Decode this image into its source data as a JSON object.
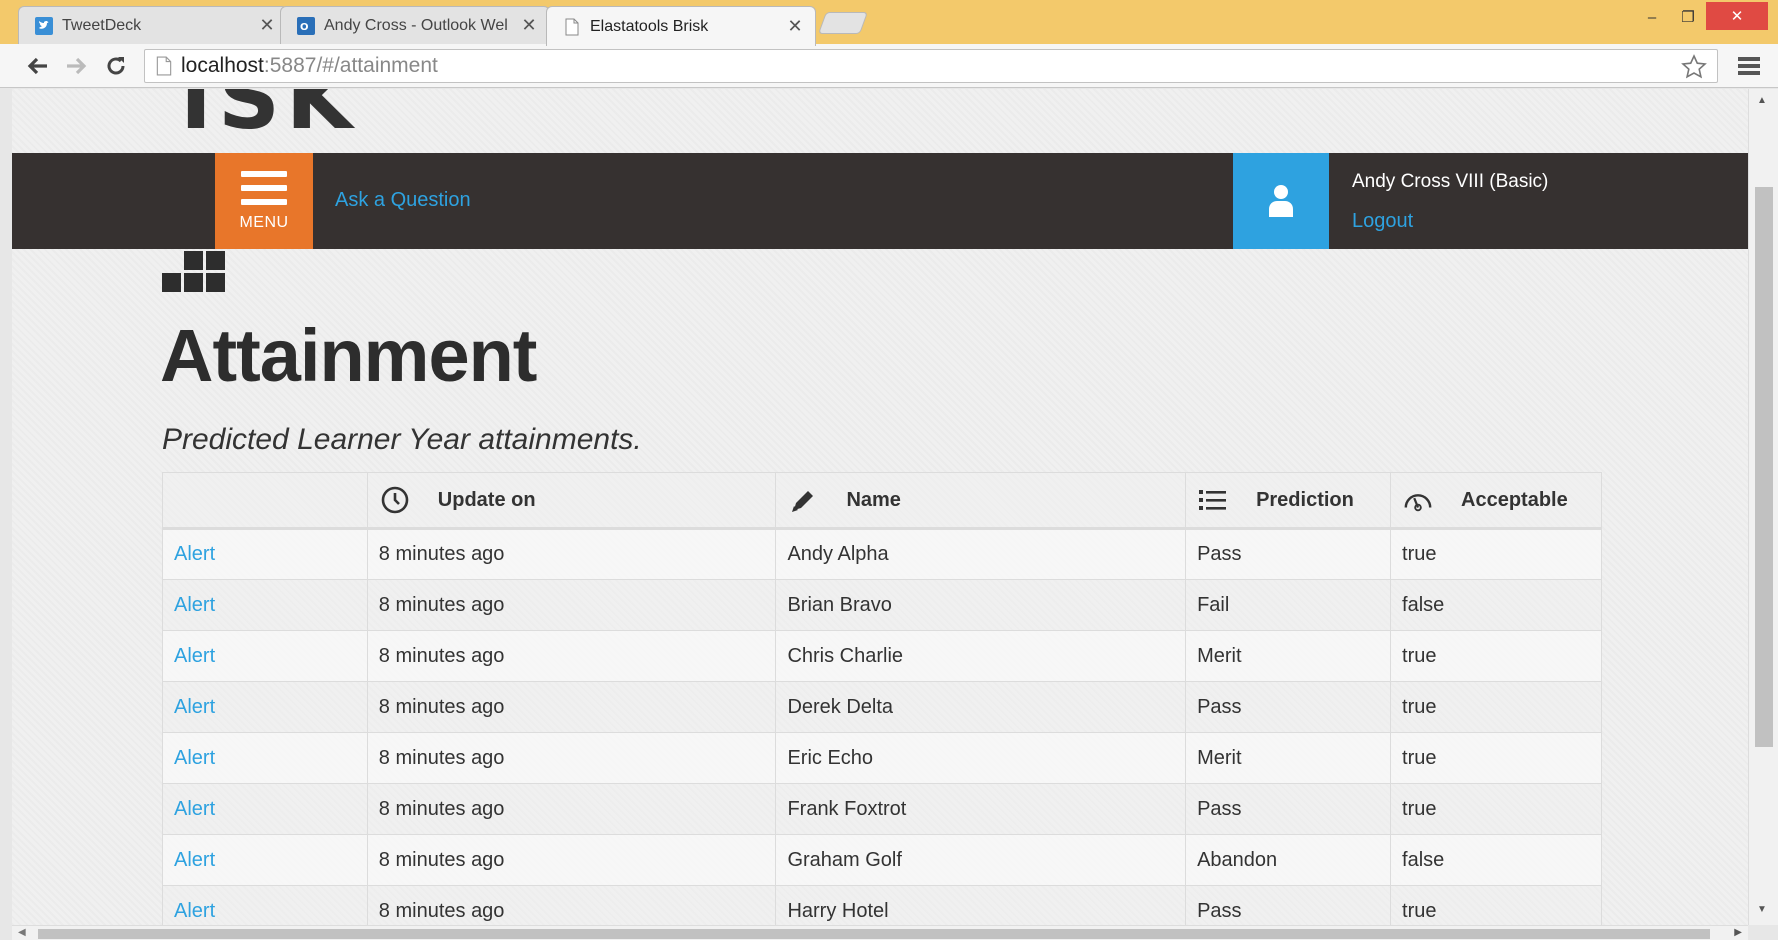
{
  "browser": {
    "tabs": [
      {
        "title": "TweetDeck",
        "icon": "twitter-bird-icon",
        "active": false
      },
      {
        "title": "Andy Cross - Outlook Wel",
        "icon": "outlook-icon",
        "active": false
      },
      {
        "title": "Elastatools Brisk",
        "icon": "document-icon",
        "active": true
      }
    ],
    "url_host": "localhost",
    "url_rest": ":5887/#/attainment",
    "window_controls": {
      "minimize": "–",
      "maximize": "❐",
      "close": "✕"
    }
  },
  "navbar": {
    "menu_label": "MENU",
    "ask_link": "Ask a Question",
    "user_name": "Andy Cross VIII (Basic)",
    "logout_label": "Logout"
  },
  "page": {
    "title": "Attainment",
    "subtitle": "Predicted Learner Year attainments."
  },
  "table": {
    "headers": [
      {
        "label": "",
        "icon": ""
      },
      {
        "label": "Update on",
        "icon": "clock-icon"
      },
      {
        "label": "Name",
        "icon": "pencil-icon"
      },
      {
        "label": "Prediction",
        "icon": "list-icon"
      },
      {
        "label": "Acceptable",
        "icon": "gauge-icon"
      }
    ],
    "rows": [
      {
        "action": "Alert",
        "updated": "8 minutes ago",
        "name": "Andy Alpha",
        "prediction": "Pass",
        "acceptable": "true"
      },
      {
        "action": "Alert",
        "updated": "8 minutes ago",
        "name": "Brian Bravo",
        "prediction": "Fail",
        "acceptable": "false"
      },
      {
        "action": "Alert",
        "updated": "8 minutes ago",
        "name": "Chris Charlie",
        "prediction": "Merit",
        "acceptable": "true"
      },
      {
        "action": "Alert",
        "updated": "8 minutes ago",
        "name": "Derek Delta",
        "prediction": "Pass",
        "acceptable": "true"
      },
      {
        "action": "Alert",
        "updated": "8 minutes ago",
        "name": "Eric Echo",
        "prediction": "Merit",
        "acceptable": "true"
      },
      {
        "action": "Alert",
        "updated": "8 minutes ago",
        "name": "Frank Foxtrot",
        "prediction": "Pass",
        "acceptable": "true"
      },
      {
        "action": "Alert",
        "updated": "8 minutes ago",
        "name": "Graham Golf",
        "prediction": "Abandon",
        "acceptable": "false"
      },
      {
        "action": "Alert",
        "updated": "8 minutes ago",
        "name": "Harry Hotel",
        "prediction": "Pass",
        "acceptable": "true"
      }
    ]
  },
  "colors": {
    "accent_orange": "#e8762a",
    "accent_blue": "#2ea2e0",
    "navbar_bg": "#363130",
    "titlebar": "#f3c96b"
  }
}
